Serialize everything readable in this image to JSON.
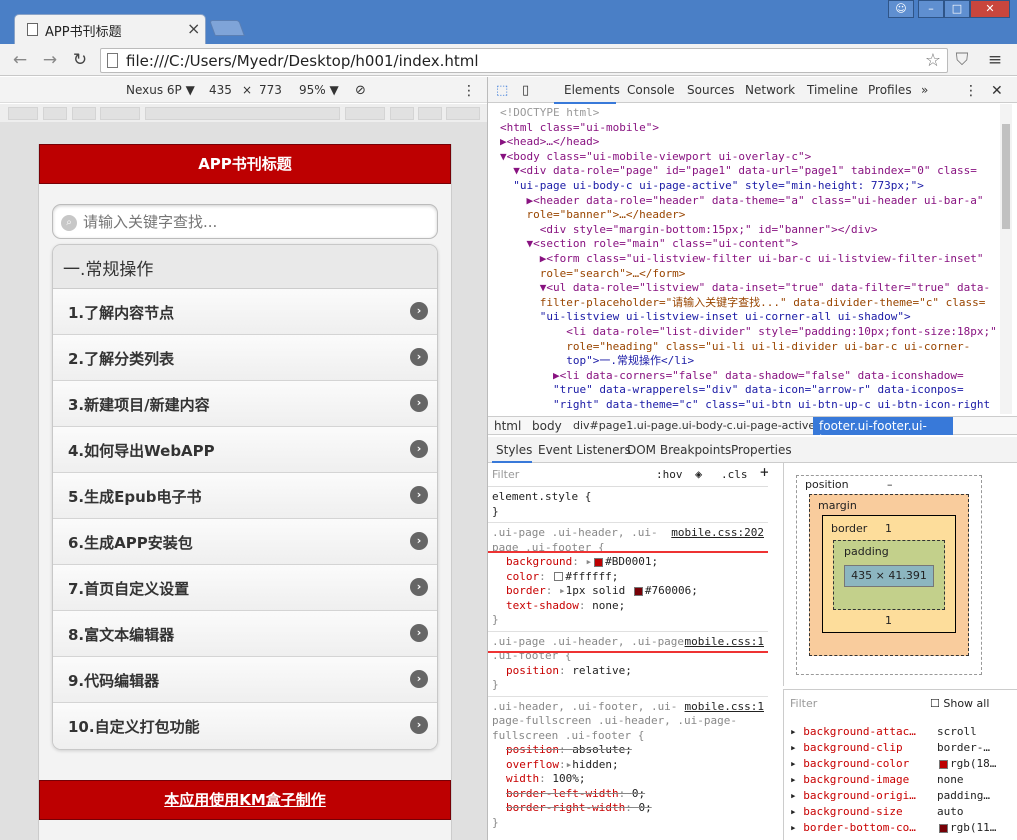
{
  "browser": {
    "tab_title": "APP书刊标题",
    "url": "file:///C:/Users/Myedr/Desktop/h001/index.html"
  },
  "device": {
    "name": "Nexus 6P ▼",
    "width": "435",
    "times": "×",
    "height": "773",
    "zoom": "95% ▼"
  },
  "app": {
    "header": "APP书刊标题",
    "search_placeholder": "请输入关键字查找...",
    "divider": "一.常规操作",
    "items": [
      "1.了解内容节点",
      "2.了解分类列表",
      "3.新建项目/新建内容",
      "4.如何导出WebAPP",
      "5.生成Epub电子书",
      "6.生成APP安装包",
      "7.首页自定义设置",
      "8.富文本编辑器",
      "9.代码编辑器",
      "10.自定义打包功能"
    ],
    "footer": "本应用使用KM盒子制作"
  },
  "devtools": {
    "tabs": [
      "Elements",
      "Console",
      "Sources",
      "Network",
      "Timeline",
      "Profiles",
      "»"
    ],
    "source_lines": [
      "<!DOCTYPE html>",
      "<html class=\"ui-mobile\">",
      "▶<head>…</head>",
      "▼<body class=\"ui-mobile-viewport ui-overlay-c\">",
      "  ▼<div data-role=\"page\" id=\"page1\" data-url=\"page1\" tabindex=\"0\" class=",
      "  \"ui-page ui-body-c ui-page-active\" style=\"min-height: 773px;\">",
      "    ▶<header data-role=\"header\" data-theme=\"a\" class=\"ui-header ui-bar-a\"",
      "    role=\"banner\">…</header>",
      "      <div style=\"margin-bottom:15px;\" id=\"banner\"></div>",
      "    ▼<section role=\"main\" class=\"ui-content\">",
      "      ▶<form class=\"ui-listview-filter ui-bar-c ui-listview-filter-inset\"",
      "      role=\"search\">…</form>",
      "      ▼<ul data-role=\"listview\" data-inset=\"true\" data-filter=\"true\" data-",
      "      filter-placeholder=\"请输入关键字查找...\" data-divider-theme=\"c\" class=",
      "      \"ui-listview ui-listview-inset ui-corner-all ui-shadow\">",
      "          <li data-role=\"list-divider\" style=\"padding:10px;font-size:18px;\"",
      "          role=\"heading\" class=\"ui-li ui-li-divider ui-bar-c ui-corner-",
      "          top\">一.常规操作</li>",
      "        ▶<li data-corners=\"false\" data-shadow=\"false\" data-iconshadow=",
      "        \"true\" data-wrapperels=\"div\" data-icon=\"arrow-r\" data-iconpos=",
      "        \"right\" data-theme=\"c\" class=\"ui-btn ui-btn-up-c ui-btn-icon-right"
    ],
    "breadcrumbs": [
      "html",
      "body",
      "div#page1.ui-page.ui-body-c.ui-page-active",
      "footer.ui-footer.ui-bar-a"
    ],
    "side_tabs": [
      "Styles",
      "Event Listeners",
      "DOM Breakpoints",
      "Properties"
    ],
    "filter_placeholder": "Filter",
    "hov": ":hov",
    "cls": ".cls",
    "rules": [
      {
        "selector": "element.style {",
        "link": "",
        "props": []
      },
      {
        "selector": ".ui-page .ui-header, .ui-page .ui-footer {",
        "link": "mobile.css:202",
        "props": [
          {
            "name": "background",
            "value": "#BD0001;",
            "color": "#BD0001"
          },
          {
            "name": "color",
            "value": "#ffffff;",
            "color": "#ffffff"
          },
          {
            "name": "border",
            "value": "1px solid #760006;",
            "color": "#760006"
          },
          {
            "name": "text-shadow",
            "value": "none;",
            "color": ""
          }
        ]
      },
      {
        "selector": ".ui-page .ui-header, .ui-page .ui-footer {",
        "link": "mobile.css:1",
        "props": [
          {
            "name": "position",
            "value": "relative;",
            "color": ""
          }
        ]
      },
      {
        "selector": ".ui-header, .ui-footer, .ui-page-fullscreen .ui-header, .ui-page-fullscreen .ui-footer {",
        "link": "mobile.css:1",
        "props": [
          {
            "name": "position",
            "value": "absolute;",
            "color": "",
            "struck": true
          },
          {
            "name": "overflow",
            "value": "hidden;",
            "color": ""
          },
          {
            "name": "width",
            "value": "100%;",
            "color": ""
          },
          {
            "name": "border-left-width",
            "value": "0;",
            "color": "",
            "struck": true
          },
          {
            "name": "border-right-width",
            "value": "0;",
            "color": "",
            "struck": true
          }
        ]
      }
    ],
    "box_model": {
      "position_label": "position",
      "margin_label": "margin",
      "border_label": "border",
      "padding_label": "padding",
      "content": "435 × 41.391",
      "dash": "–",
      "border_value": "1"
    },
    "computed_filter": "Filter",
    "show_all": "Show all",
    "computed": [
      {
        "name": "background-attac…",
        "value": "scroll",
        "color": ""
      },
      {
        "name": "background-clip",
        "value": "border-…",
        "color": ""
      },
      {
        "name": "background-color",
        "value": "rgb(18…",
        "color": "#BD0001"
      },
      {
        "name": "background-image",
        "value": "none",
        "color": ""
      },
      {
        "name": "background-origi…",
        "value": "padding…",
        "color": ""
      },
      {
        "name": "background-size",
        "value": "auto",
        "color": ""
      },
      {
        "name": "border-bottom-co…",
        "value": "rgb(11…",
        "color": "#760006"
      }
    ]
  }
}
